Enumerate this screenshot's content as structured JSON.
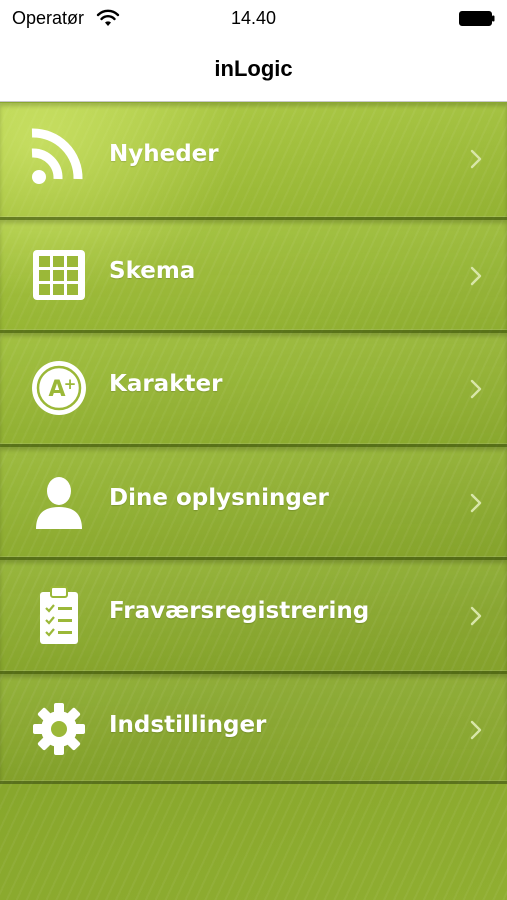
{
  "statusbar": {
    "carrier": "Operatør",
    "time": "14.40"
  },
  "navbar": {
    "title": "inLogic"
  },
  "menu": {
    "items": [
      {
        "label": "Nyheder",
        "icon": "rss-icon"
      },
      {
        "label": "Skema",
        "icon": "schedule-grid-icon"
      },
      {
        "label": "Karakter",
        "icon": "grade-a-plus-icon"
      },
      {
        "label": "Dine oplysninger",
        "icon": "user-icon"
      },
      {
        "label": "Fraværsregistrering",
        "icon": "clipboard-checklist-icon"
      },
      {
        "label": "Indstillinger",
        "icon": "gear-icon"
      }
    ]
  },
  "colors": {
    "accent_green": "#97b734",
    "label_white": "#ffffff"
  }
}
